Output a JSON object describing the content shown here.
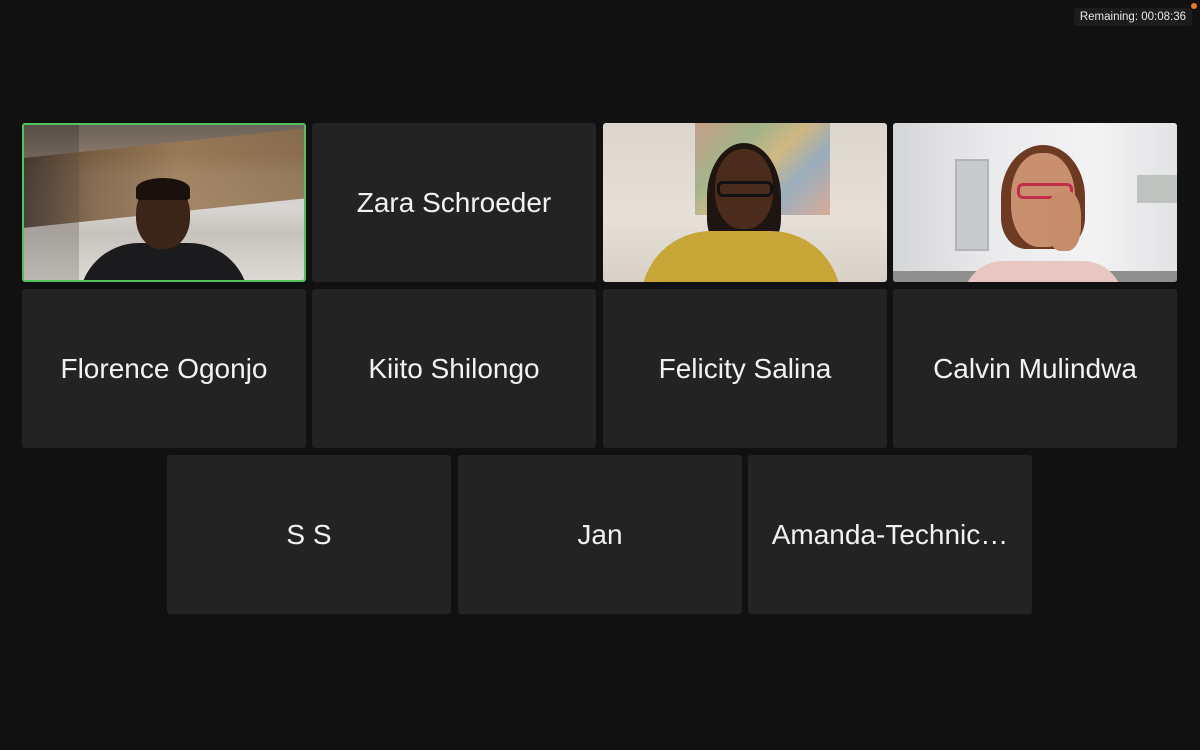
{
  "meeting": {
    "remaining_label": "Remaining: 00:08:36"
  },
  "tiles": [
    {
      "type": "video",
      "name": "",
      "active_speaker": true
    },
    {
      "type": "name",
      "name": "Zara Schroeder"
    },
    {
      "type": "video",
      "name": ""
    },
    {
      "type": "video",
      "name": ""
    },
    {
      "type": "name",
      "name": "Florence Ogonjo"
    },
    {
      "type": "name",
      "name": "Kiito Shilongo"
    },
    {
      "type": "name",
      "name": "Felicity Salina"
    },
    {
      "type": "name",
      "name": "Calvin Mulindwa"
    },
    {
      "type": "name",
      "name": "S S"
    },
    {
      "type": "name",
      "name": "Jan"
    },
    {
      "type": "name",
      "name": "Amanda-Technic…"
    }
  ],
  "colors": {
    "background": "#111111",
    "tile": "#232323",
    "active_border": "#4fc35a",
    "recording_dot": "#e8772a"
  }
}
